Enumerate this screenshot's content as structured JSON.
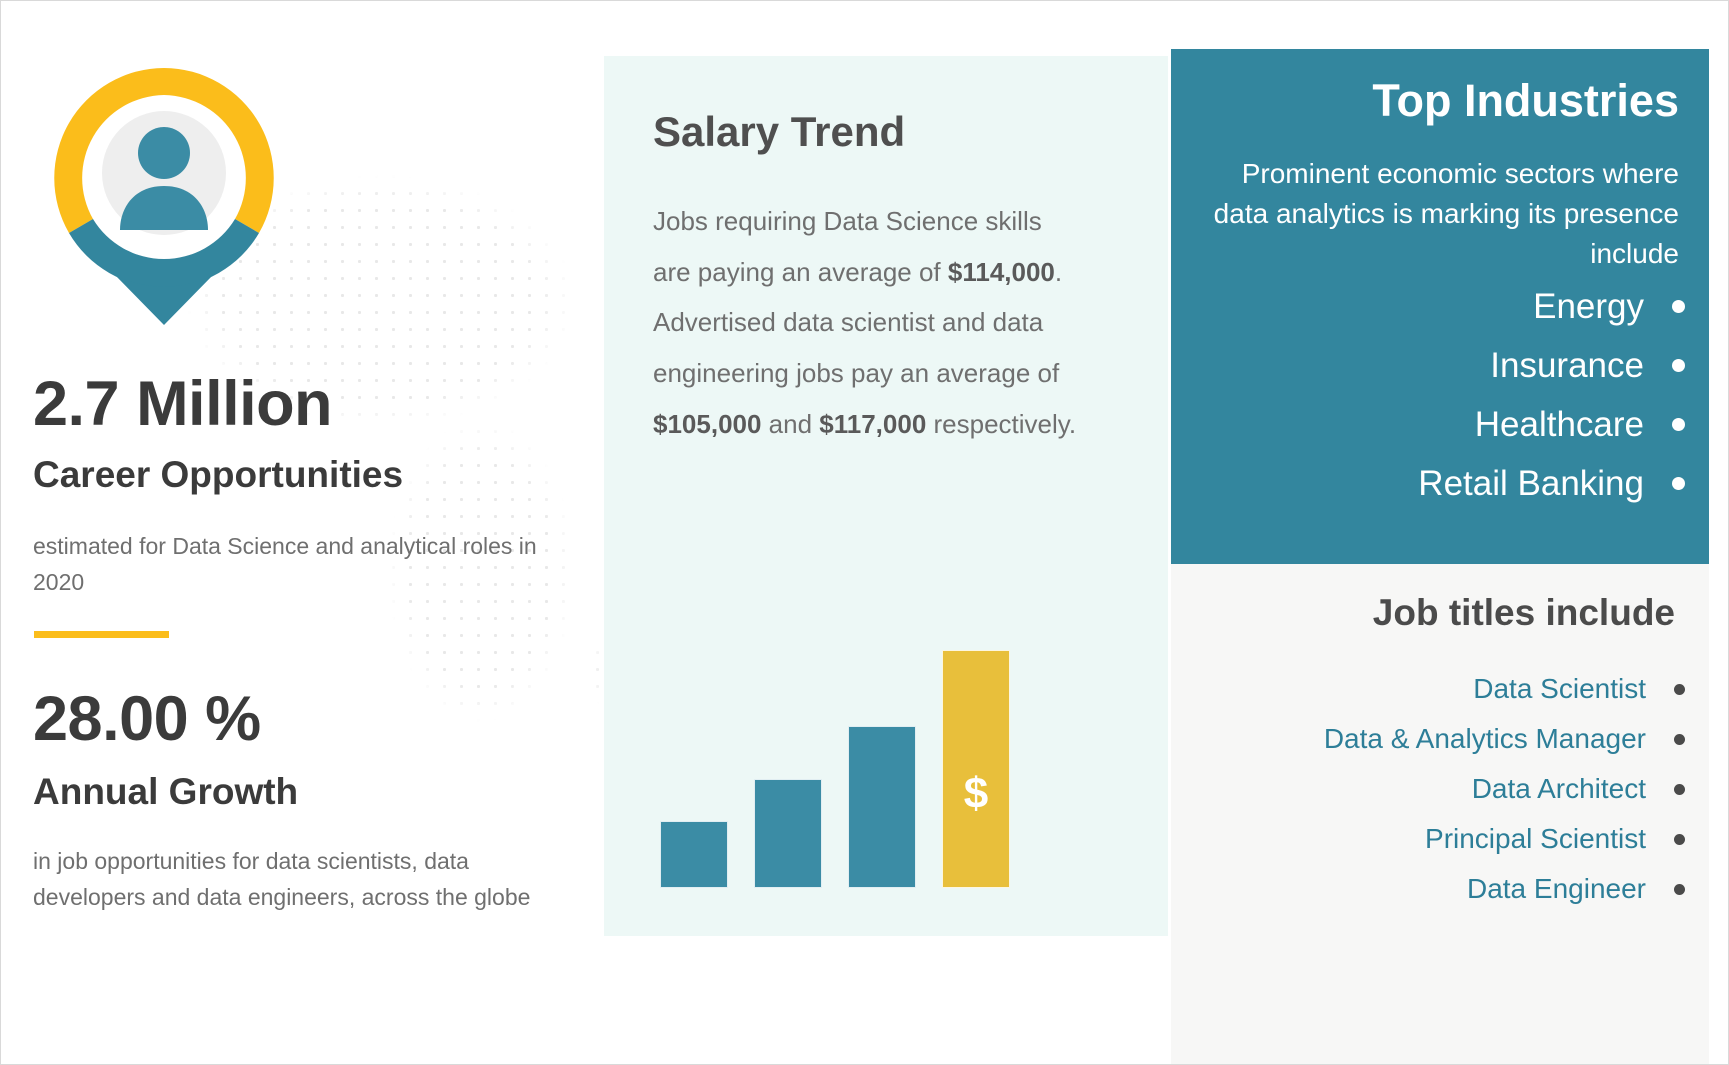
{
  "left": {
    "icon": "location-pin-person-icon",
    "stat1": {
      "value": "2.7 Million",
      "label": "Career Opportunities",
      "description": "estimated for Data Science and analytical roles in 2020"
    },
    "stat2": {
      "value": "28.00 %",
      "label": "Annual Growth",
      "description": "in job opportunities for data scientists, data developers and data engineers, across the globe"
    }
  },
  "salary": {
    "title": "Salary Trend",
    "body_parts": [
      {
        "text": "Jobs requiring Data Science skills are paying an average of ",
        "bold": false
      },
      {
        "text": "$114,000",
        "bold": true
      },
      {
        "text": ". Advertised data scientist and data engineering jobs pay an average of ",
        "bold": false
      },
      {
        "text": "$105,000",
        "bold": true
      },
      {
        "text": " and ",
        "bold": false
      },
      {
        "text": "$117,000",
        "bold": true
      },
      {
        "text": " respectively.",
        "bold": false
      }
    ],
    "average_salary": "$114,000",
    "data_scientist_salary": "$105,000",
    "data_engineer_salary": "$117,000",
    "bar_symbol": "$"
  },
  "chart_data": {
    "type": "bar",
    "title": "Salary Trend",
    "categories": [
      "",
      "",
      "",
      ""
    ],
    "values": [
      28,
      46,
      68,
      100
    ],
    "colors": [
      "#3b8ca5",
      "#3b8ca5",
      "#3b8ca5",
      "#e8bf3b"
    ],
    "xlabel": "",
    "ylabel": "",
    "ylim": [
      0,
      100
    ],
    "grid": false,
    "legend": "none",
    "annotations": [
      "$"
    ]
  },
  "industries": {
    "title": "Top Industries",
    "description": "Prominent economic sectors where data analytics is marking its presence include",
    "items": [
      "Energy",
      "Insurance",
      "Healthcare",
      "Retail Banking"
    ]
  },
  "jobs": {
    "title": "Job titles include",
    "items": [
      "Data Scientist",
      "Data & Analytics Manager",
      "Data Architect",
      "Principal Scientist",
      "Data Engineer"
    ]
  },
  "colors": {
    "teal": "#33869e",
    "yellow": "#fbbd1b",
    "gold_bar": "#e8bf3b",
    "bar_teal": "#3b8ca5",
    "mint_panel": "#edf8f6",
    "offwhite_panel": "#f7f7f6",
    "heading_gray": "#3b3b3b",
    "body_gray": "#6f6f6f",
    "job_text": "#2d7e98"
  }
}
